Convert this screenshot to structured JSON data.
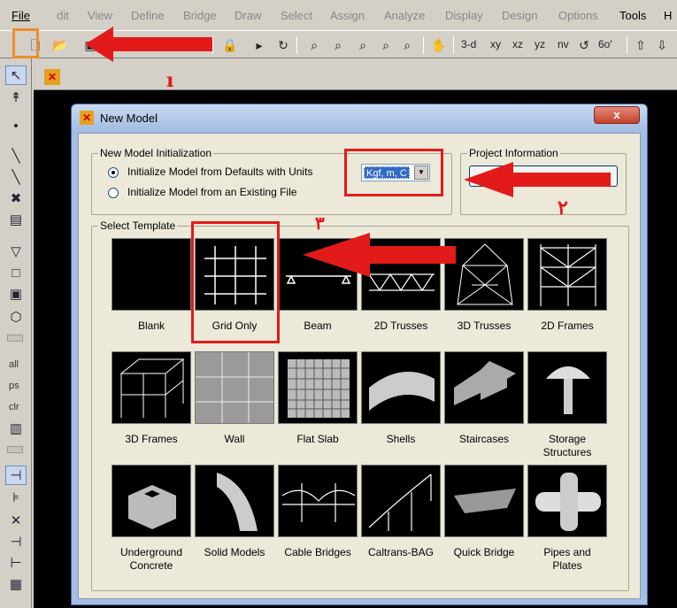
{
  "menubar": {
    "items": [
      "File",
      "dit",
      "View",
      "Define",
      "Bridge",
      "Draw",
      "Select",
      "Assign",
      "Analyze",
      "Display",
      "Design",
      "Options",
      "Tools",
      "H"
    ]
  },
  "toolbar": {
    "view_labels": [
      "3-d",
      "xy",
      "xz",
      "yz",
      "nv",
      "6o'"
    ]
  },
  "left_palette": {
    "tags": [
      "all",
      "ps",
      "clr"
    ]
  },
  "dialog": {
    "title": "New Model",
    "close_label": "x",
    "init_group": {
      "label": "New Model Initialization",
      "option_defaults": "Initialize Model from Defaults with Units",
      "option_existing": "Initialize Model  from an Existing File",
      "selected": "defaults",
      "units_value": "Kgf, m, C"
    },
    "project_group": {
      "label": "Project Information"
    },
    "template_group": {
      "label": "Select Template",
      "templates": [
        "Blank",
        "Grid Only",
        "Beam",
        "2D Trusses",
        "3D Trusses",
        "2D Frames",
        "3D Frames",
        "Wall",
        "Flat Slab",
        "Shells",
        "Staircases",
        "Storage\nStructures",
        "Underground\nConcrete",
        "Solid Models",
        "Cable Bridges",
        "Caltrans-BAG",
        "Quick Bridge",
        "Pipes and\nPlates"
      ]
    }
  },
  "annotations": {
    "arrow_colors": {
      "red": "#e21a1a",
      "orange": "#f08c2a"
    },
    "marks": [
      "ı",
      "٢",
      "٣"
    ]
  }
}
